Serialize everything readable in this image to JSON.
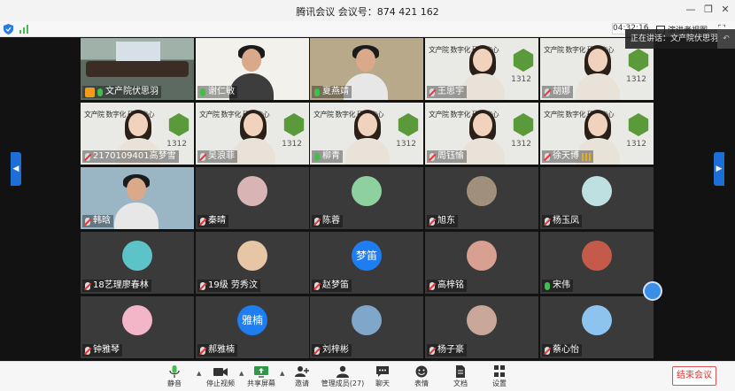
{
  "window": {
    "title": "腾讯会议 会议号：874 421 162",
    "minimize": "—",
    "restore": "❐",
    "close": "✕"
  },
  "status": {
    "timer": "04:32:16",
    "view_label": "演讲者视图",
    "fullscreen": "⛶"
  },
  "speaking": {
    "text": "正在讲话：文产院伏思羽...",
    "back": "↶"
  },
  "nav": {
    "left": "◀",
    "right": "▶"
  },
  "participants": [
    {
      "name": "文产院伏思羽",
      "mic": "on",
      "host": true,
      "type": "room"
    },
    {
      "name": "谢仁敏",
      "mic": "on",
      "type": "man1"
    },
    {
      "name": "夏燕靖",
      "mic": "on",
      "type": "man2"
    },
    {
      "name": "王思宇",
      "mic": "off",
      "type": "girl",
      "banner": "文产院 数字化 研究中心"
    },
    {
      "name": "胡娜",
      "mic": "off",
      "type": "girl",
      "banner": "文产院 数字化 研究中心"
    },
    {
      "name": "2170109401高梦雪",
      "mic": "off",
      "type": "girl",
      "banner": "文产院 数字化 研究中心"
    },
    {
      "name": "吴浪菲",
      "mic": "off",
      "type": "girl",
      "banner": "文产院 数字化 研究中心"
    },
    {
      "name": "柳青",
      "mic": "on",
      "type": "girl",
      "banner": "文产院 数字化 研究中心"
    },
    {
      "name": "周钰愉",
      "mic": "off",
      "type": "girl",
      "banner": "文产院 数字化 研究中心"
    },
    {
      "name": "徐天博",
      "mic": "off",
      "vol": true,
      "type": "girl",
      "banner": "文产院 数字化 研究中心"
    },
    {
      "name": "韩晗",
      "mic": "off",
      "type": "man3"
    },
    {
      "name": "秦晴",
      "mic": "off",
      "type": "avatar",
      "color": "#d9b4b4"
    },
    {
      "name": "陈蓉",
      "mic": "off",
      "type": "avatar",
      "color": "#8fd19e"
    },
    {
      "name": "旭东",
      "mic": "off",
      "type": "avatar",
      "color": "#a08f7a"
    },
    {
      "name": "杨玉凤",
      "mic": "off",
      "type": "avatar",
      "color": "#bfe0e0"
    },
    {
      "name": "18艺理廖春林",
      "mic": "off",
      "type": "avatar",
      "color": "#5cc4c8"
    },
    {
      "name": "19级 劳秀汶",
      "mic": "off",
      "type": "avatar",
      "color": "#e7c6a6"
    },
    {
      "name": "赵梦笛",
      "mic": "off",
      "type": "text-avatar",
      "avatar_text": "梦笛"
    },
    {
      "name": "高梓铭",
      "mic": "off",
      "type": "avatar",
      "color": "#d8a090"
    },
    {
      "name": "宋伟",
      "mic": "on",
      "type": "avatar",
      "color": "#c45a4a"
    },
    {
      "name": "钟雅琴",
      "mic": "off",
      "type": "avatar",
      "color": "#f3b6c8"
    },
    {
      "name": "郝雅楠",
      "mic": "off",
      "type": "text-avatar",
      "avatar_text": "雅楠"
    },
    {
      "name": "刘梓彬",
      "mic": "off",
      "type": "avatar",
      "color": "#7fa7c9"
    },
    {
      "name": "杨子豪",
      "mic": "off",
      "type": "avatar",
      "color": "#c9a89a"
    },
    {
      "name": "蔡心怡",
      "mic": "off",
      "type": "avatar",
      "color": "#8cc4ef"
    }
  ],
  "hex_label": "1312",
  "toolbar": {
    "mute": "静音",
    "stop_video": "停止视频",
    "share": "共享屏幕",
    "invite": "邀请",
    "members": "管理成员(27)",
    "chat": "聊天",
    "emoji": "表情",
    "docs": "文档",
    "settings": "设置",
    "end": "结束会议",
    "caret": "▲"
  },
  "colors": {
    "accent": "#1e6ed8",
    "end": "#e03333",
    "mic_on": "#3fc04a"
  }
}
